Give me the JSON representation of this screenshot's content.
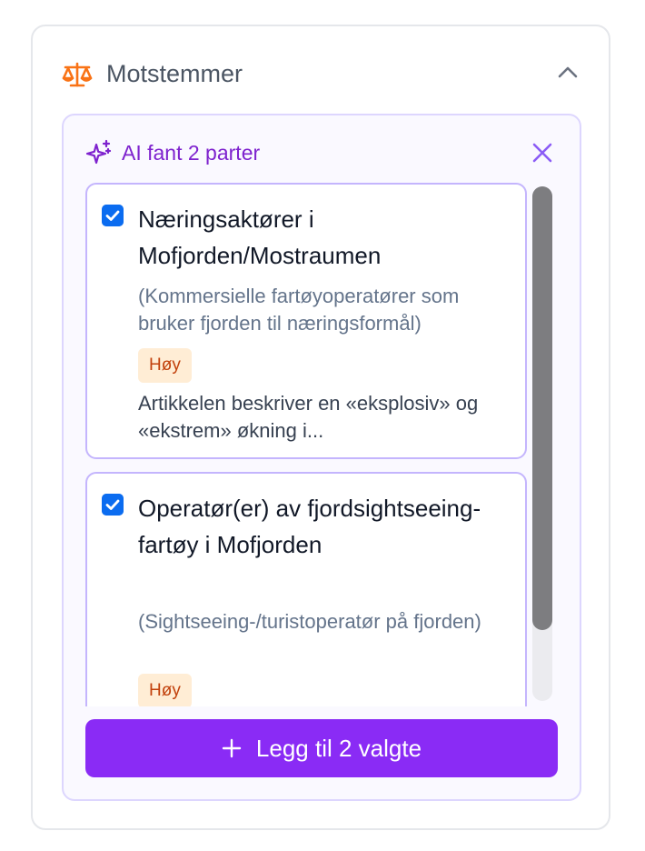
{
  "section": {
    "title": "Motstemmer",
    "icon": "scale-icon",
    "collapse_icon": "chevron-up-icon"
  },
  "ai_panel": {
    "title": "AI fant 2 parter",
    "icon": "sparkle-icon",
    "close_icon": "close-icon",
    "parties": [
      {
        "name": "Næringsaktører i Mofjorden/Mostraumen",
        "description": "(Kommersielle fartøyoperatører som bruker fjorden til næringsformål)",
        "badge": "Høy",
        "note": "Artikkelen beskriver en «eksplosiv» og «ekstrem» økning i...",
        "checked": true
      },
      {
        "name": "Operatør(er) av fjordsightseeing-fartøy i Mofjorden",
        "description": "(Sightseeing-/turistoperatør på fjorden)",
        "badge": "Høy",
        "checked": true
      }
    ],
    "add_button_label": "Legg til 2 valgte"
  },
  "colors": {
    "accent": "#8a2bf5",
    "ai_text": "#7e22ce",
    "checkbox": "#0b6cf0",
    "badge_bg": "#ffedd5",
    "badge_text": "#c2410c",
    "icon_orange": "#f97316"
  }
}
